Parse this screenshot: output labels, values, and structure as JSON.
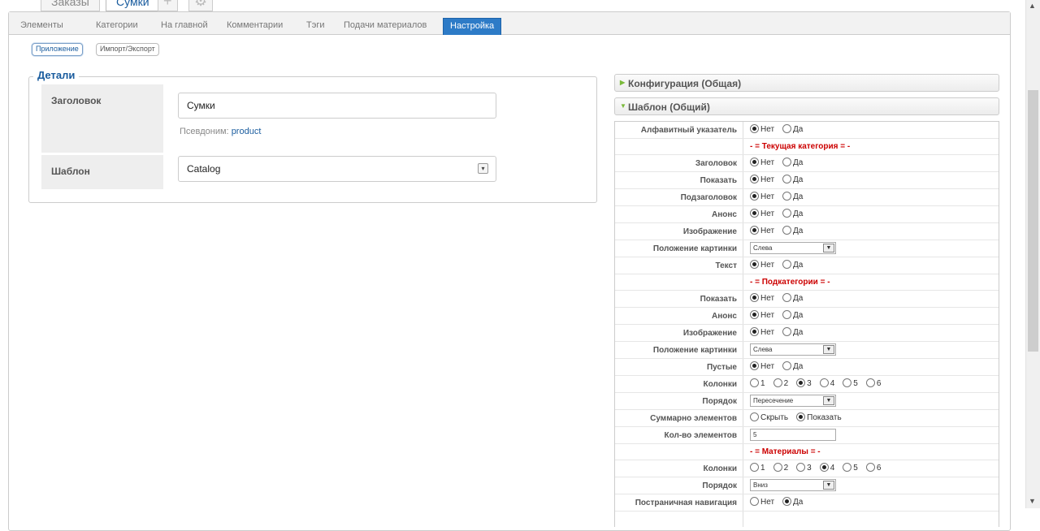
{
  "app_tabs": {
    "orders": "Заказы",
    "bags": "Сумки",
    "add_icon": "plus-icon",
    "settings_icon": "gear-icon"
  },
  "subtabs": [
    "Элементы",
    "Категории",
    "На главной",
    "Комментарии",
    "Тэги",
    "Подачи материалов",
    "Настройка"
  ],
  "pills": [
    "Приложение",
    "Импорт/Экспорт"
  ],
  "details": {
    "legend": "Детали",
    "title_label": "Заголовок",
    "title_value": "Сумки",
    "alias_label": "Псевдоним:",
    "alias_value": "product",
    "template_label": "Шаблон",
    "template_value": "Catalog"
  },
  "accordion": {
    "config": "Конфигурация (Общая)",
    "template": "Шаблон (Общий)"
  },
  "params": {
    "alpha_index": "Алфавитный указатель",
    "sect_current": "- = Текущая категория = -",
    "title": "Заголовок",
    "show": "Показать",
    "subtitle": "Подзаголовок",
    "teaser": "Анонс",
    "image": "Изображение",
    "image_pos": "Положение картинки",
    "text": "Текст",
    "sect_sub": "- = Подкатегории = -",
    "empty": "Пустые",
    "columns": "Колонки",
    "order": "Порядок",
    "total_items": "Суммарно элементов",
    "items_count": "Кол-во элементов",
    "sect_items": "- = Материалы = -",
    "pagination": "Постраничная навигация"
  },
  "options": {
    "no": "Нет",
    "yes": "Да",
    "hide": "Скрыть",
    "show": "Показать",
    "left": "Слева",
    "intersect": "Пересечение",
    "down": "Вниз",
    "c1": "1",
    "c2": "2",
    "c3": "3",
    "c4": "4",
    "c5": "5",
    "c6": "6",
    "items_count_value": "5"
  }
}
